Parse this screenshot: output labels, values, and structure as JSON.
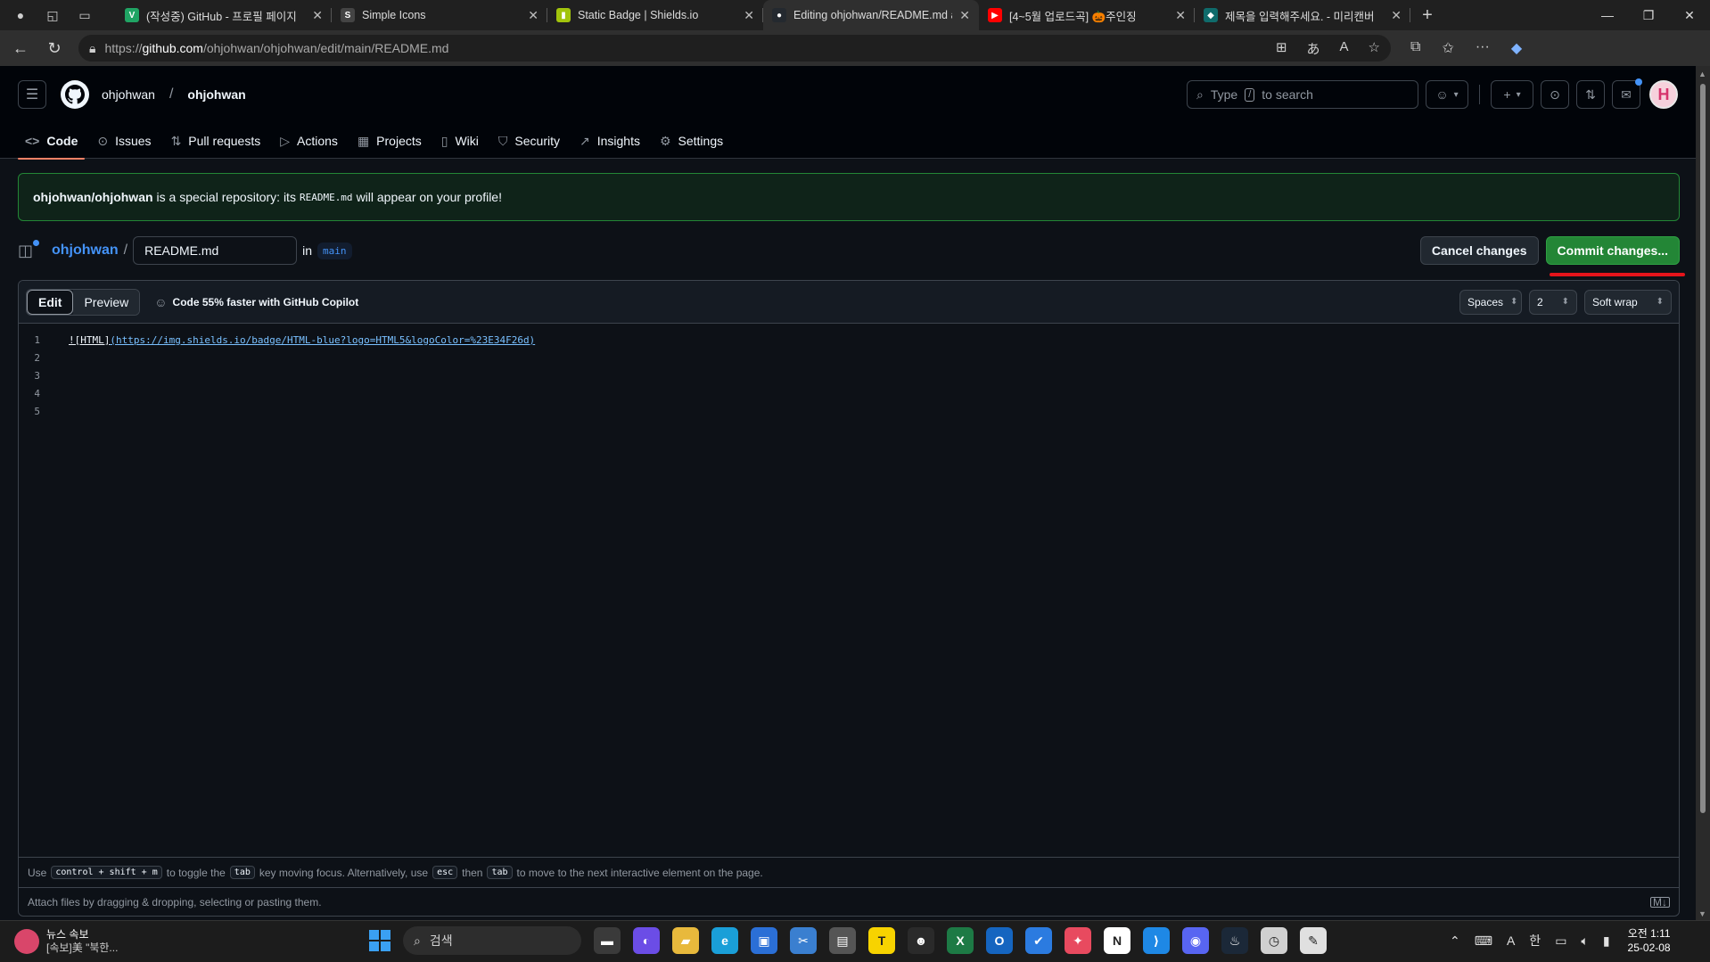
{
  "browser": {
    "tabs": [
      {
        "title": "(작성중) GitHub - 프로필 페이지",
        "favicon": "V",
        "color": "#20a464",
        "active": false
      },
      {
        "title": "Simple Icons",
        "favicon": "S",
        "color": "#444444",
        "active": false
      },
      {
        "title": "Static Badge | Shields.io",
        "favicon": "▮",
        "color": "#a2c40c",
        "active": false
      },
      {
        "title": "Editing ohjohwan/README.md at",
        "favicon": "●",
        "color": "#24292f",
        "active": true
      },
      {
        "title": "[4~5월 업로드곡] 🎃주인징",
        "favicon": "▶",
        "color": "#ff0000",
        "active": false
      },
      {
        "title": "제목을 입력해주세요. - 미리캔버",
        "favicon": "◆",
        "color": "#0f6b6b",
        "active": false
      }
    ],
    "url_prefix": "https://",
    "url_host": "github.com",
    "url_path": "/ohjohwan/ohjohwan/edit/main/README.md"
  },
  "header": {
    "owner": "ohjohwan",
    "repo": "ohjohwan",
    "search_placeholder_pre": "Type",
    "search_key": "/",
    "search_placeholder_post": "to search"
  },
  "repo_tabs": [
    {
      "label": "Code",
      "icon": "code-icon",
      "glyph": "<>",
      "selected": true
    },
    {
      "label": "Issues",
      "icon": "issue-icon",
      "glyph": "⊙",
      "selected": false
    },
    {
      "label": "Pull requests",
      "icon": "pull-request-icon",
      "glyph": "⇅",
      "selected": false
    },
    {
      "label": "Actions",
      "icon": "play-icon",
      "glyph": "▷",
      "selected": false
    },
    {
      "label": "Projects",
      "icon": "table-icon",
      "glyph": "▦",
      "selected": false
    },
    {
      "label": "Wiki",
      "icon": "book-icon",
      "glyph": "▯",
      "selected": false
    },
    {
      "label": "Security",
      "icon": "shield-icon",
      "glyph": "⛉",
      "selected": false
    },
    {
      "label": "Insights",
      "icon": "graph-icon",
      "glyph": "↗",
      "selected": false
    },
    {
      "label": "Settings",
      "icon": "gear-icon",
      "glyph": "⚙",
      "selected": false
    }
  ],
  "flash": {
    "repo": "ohjohwan/ohjohwan",
    "text_a": "is a special repository: its",
    "code": "README.md",
    "text_b": "will appear on your profile!"
  },
  "path": {
    "owner": "ohjohwan",
    "separator": "/",
    "filename": "README.md",
    "in_label": "in",
    "branch": "main",
    "cancel_label": "Cancel changes",
    "commit_label": "Commit changes..."
  },
  "editor": {
    "edit_label": "Edit",
    "preview_label": "Preview",
    "copilot_label": "Code 55% faster with GitHub Copilot",
    "indent_mode": "Spaces",
    "indent_size": "2",
    "wrap_mode": "Soft wrap",
    "lines": [
      {
        "num": "1",
        "alt": "![HTML]",
        "url": "(https://img.shields.io/badge/HTML-blue?logo=HTML5&logoColor=%23E34F26d)"
      },
      {
        "num": "2",
        "alt": "",
        "url": ""
      },
      {
        "num": "3",
        "alt": "",
        "url": ""
      },
      {
        "num": "4",
        "alt": "",
        "url": ""
      },
      {
        "num": "5",
        "alt": "",
        "url": ""
      }
    ],
    "hint": {
      "use": "Use",
      "keys": "control + shift + m",
      "t1": "to toggle the",
      "tab": "tab",
      "t2": "key moving focus. Alternatively, use",
      "esc": "esc",
      "then": "then",
      "tab2": "tab",
      "t3": "to move to the next interactive element on the page."
    },
    "attach_text": "Attach files by dragging & dropping, selecting or pasting them."
  },
  "taskbar": {
    "news_title": "뉴스 속보",
    "news_sub": "[속보]美 \"북한...",
    "search_label": "검색",
    "apps": [
      {
        "name": "file-explorer-icon",
        "color": "#3a3a3a",
        "glyph": "▬"
      },
      {
        "name": "copilot-app-icon",
        "color": "#6b4de6",
        "glyph": "◐"
      },
      {
        "name": "folder-icon",
        "color": "#e8b93c",
        "glyph": "▰"
      },
      {
        "name": "edge-icon",
        "color": "#1a9fd8",
        "glyph": "e"
      },
      {
        "name": "store-icon",
        "color": "#2b6fd6",
        "glyph": "▣"
      },
      {
        "name": "snipping-icon",
        "color": "#3a7fd0",
        "glyph": "✂"
      },
      {
        "name": "notepad-icon",
        "color": "#555555",
        "glyph": "▤"
      },
      {
        "name": "kakaotalk-icon",
        "color": "#f7d300",
        "glyph": "T"
      },
      {
        "name": "alien-icon",
        "color": "#2a2a2a",
        "glyph": "☻"
      },
      {
        "name": "excel-icon",
        "color": "#1d7a45",
        "glyph": "X"
      },
      {
        "name": "outlook-icon",
        "color": "#1565c0",
        "glyph": "O"
      },
      {
        "name": "todo-icon",
        "color": "#2b7be0",
        "glyph": "✔"
      },
      {
        "name": "game-icon",
        "color": "#e84a5f",
        "glyph": "✦"
      },
      {
        "name": "notion-icon",
        "color": "#ffffff",
        "glyph": "N"
      },
      {
        "name": "vscode-icon",
        "color": "#1e88e5",
        "glyph": "⟩"
      },
      {
        "name": "discord-icon",
        "color": "#5865f2",
        "glyph": "◉"
      },
      {
        "name": "steam-icon",
        "color": "#1b2838",
        "glyph": "♨"
      },
      {
        "name": "clock-app-icon",
        "color": "#d0d0d0",
        "glyph": "◷"
      },
      {
        "name": "paint-icon",
        "color": "#e0e0e0",
        "glyph": "✎"
      }
    ],
    "ampm": "오전 1:11",
    "date": "25-02-08",
    "lang": "한",
    "font_a": "A"
  }
}
